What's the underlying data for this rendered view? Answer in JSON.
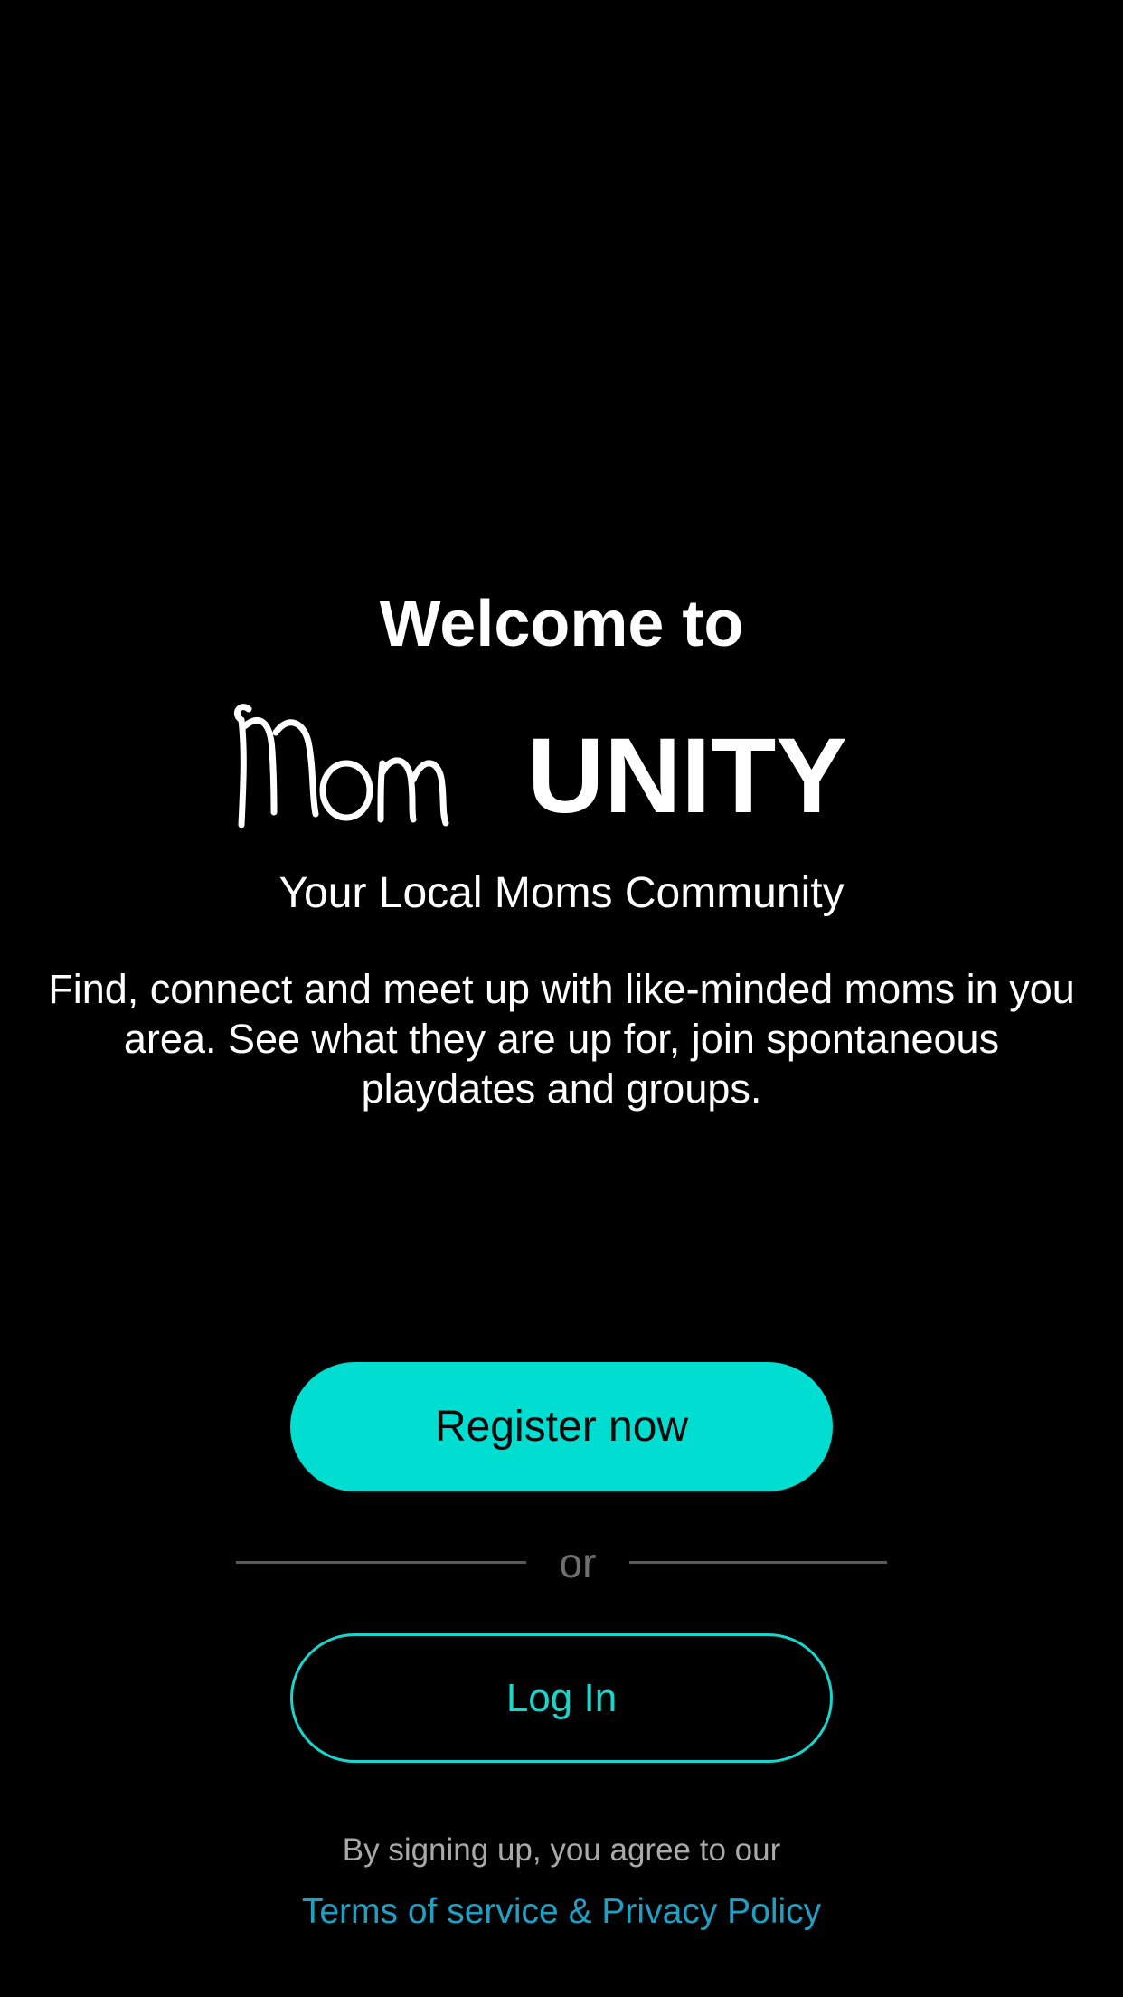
{
  "welcome": {
    "heading": "Welcome to",
    "logo": {
      "script_part": "Mom",
      "bold_part": "UNITY"
    },
    "tagline": "Your Local Moms Community",
    "description": "Find, connect and meet up with like-minded moms in you area. See what they are up for, join spontaneous playdates and groups."
  },
  "actions": {
    "register_label": "Register now",
    "divider_label": "or",
    "login_label": "Log In"
  },
  "legal": {
    "consent_text": "By signing up, you agree to our",
    "terms_link": "Terms of service & Privacy Policy"
  },
  "colors": {
    "background": "#000000",
    "accent": "#00ddd1",
    "login_outline": "#17d6cc",
    "link": "#1f9fc4",
    "muted_text": "#a9a9a9",
    "divider": "#5a5a5a"
  }
}
